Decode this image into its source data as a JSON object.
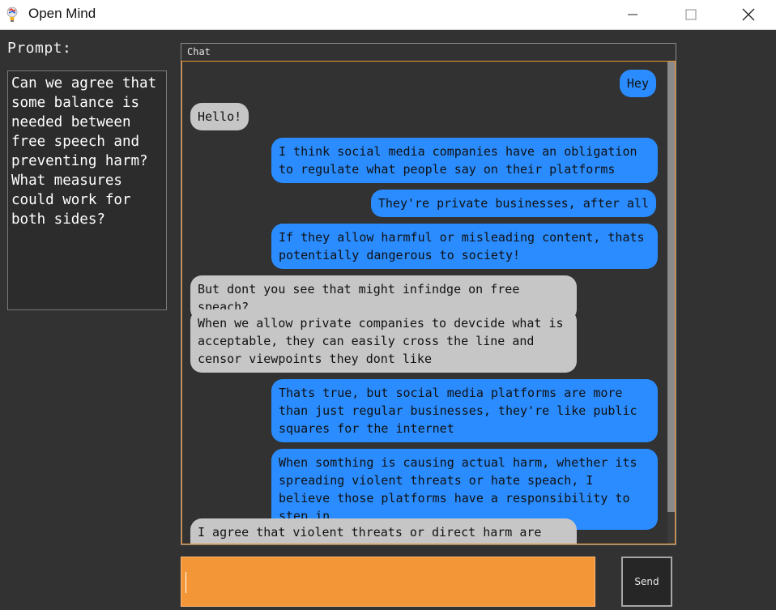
{
  "window": {
    "title": "Open Mind",
    "icon": "lightbulb-icon",
    "controls": {
      "minimize": "—",
      "maximize": "☐",
      "close": "✕"
    }
  },
  "prompt": {
    "label": "Prompt:",
    "text": "Can we agree that some balance is needed between free speech and preventing harm? What measures could work for both sides?"
  },
  "chat": {
    "header": "Chat",
    "messages": [
      {
        "role": "user",
        "text": "Hey"
      },
      {
        "role": "bot",
        "text": "Hello!"
      },
      {
        "role": "user",
        "text": "I think social media companies have an obligation to regulate what people say on their platforms"
      },
      {
        "role": "user",
        "text": "They're private businesses, after all"
      },
      {
        "role": "user",
        "text": "If they allow harmful or misleading content, thats potentially dangerous to society!"
      },
      {
        "role": "bot",
        "text": "But dont you see that might infindge on free speach?"
      },
      {
        "role": "bot",
        "text": "When we allow private companies to devcide what is acceptable, they can easily cross the line and censor viewpoints they dont like"
      },
      {
        "role": "user",
        "text": "Thats true, but social media platforms are more than just regular businesses, they're like public squares for the internet"
      },
      {
        "role": "user",
        "text": "When somthing is causing actual harm, whether its spreading violent threats or hate speach, I believe those platforms have a responsibility to step in"
      },
      {
        "role": "bot",
        "text": "I agree that violent threats or direct harm are unacceptable, the question is where do we draw the line"
      }
    ]
  },
  "composer": {
    "value": "",
    "send_label": "Send"
  },
  "colors": {
    "accent": "#f39638",
    "user_bubble": "#2a8cff",
    "bot_bubble": "#c6c6c6",
    "background": "#323232"
  }
}
